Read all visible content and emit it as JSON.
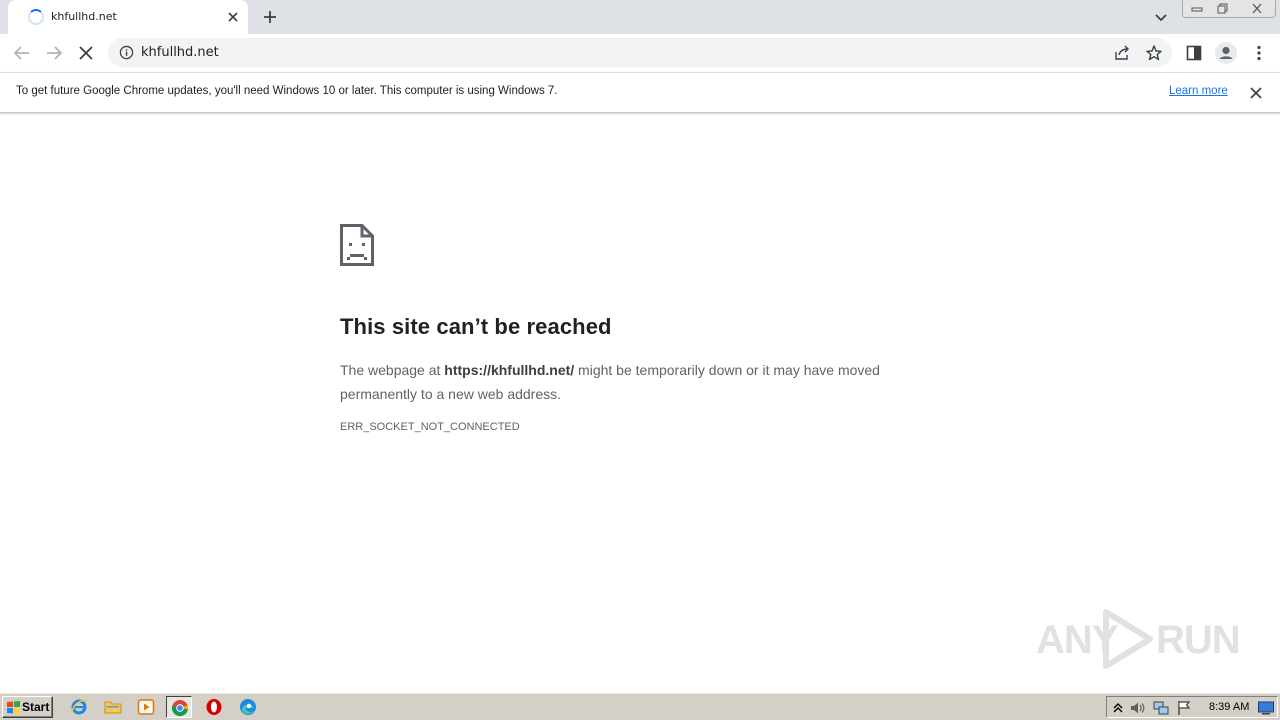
{
  "browser": {
    "tab": {
      "title": "khfullhd.net",
      "close_icon": "close-icon"
    },
    "new_tab_label": "+",
    "toolbar": {
      "url": "khfullhd.net"
    },
    "infobar": {
      "message": "To get future Google Chrome updates, you'll need Windows 10 or later. This computer is using Windows 7.",
      "link": "Learn more"
    }
  },
  "error_page": {
    "title": "This site can’t be reached",
    "body_prefix": "The webpage at ",
    "body_url": "https://khfullhd.net/",
    "body_suffix": " might be temporarily down or it may have moved permanently to a new web address.",
    "code": "ERR_SOCKET_NOT_CONNECTED"
  },
  "watermark": {
    "left": "ANY",
    "right": "RUN"
  },
  "taskbar": {
    "start_label": "Start",
    "clock": "8:39 AM"
  },
  "colors": {
    "accent": "#1a73e8",
    "tabstrip": "#dee1e6",
    "omnibox": "#f1f3f4",
    "taskbar": "#d4d0c8"
  }
}
